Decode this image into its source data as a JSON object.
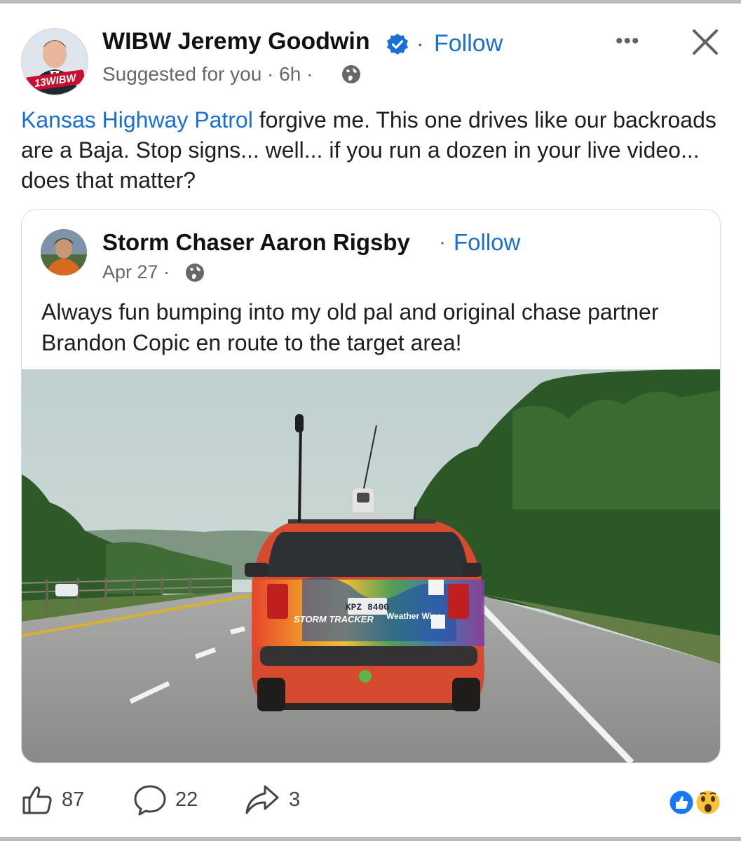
{
  "post": {
    "author": "WIBW Jeremy Goodwin",
    "separator": "·",
    "follow": "Follow",
    "meta": "Suggested for you · 6h ·",
    "more": "•••",
    "mention": "Kansas Highway Patrol",
    "text": " forgive me.  This one drives like our backroads are a Baja.  Stop signs... well... if you run a dozen in your live video... does that matter?",
    "avatar_badge": "13WIBW"
  },
  "shared": {
    "author": "Storm Chaser Aaron Rigsby",
    "separator": "·",
    "follow": "Follow",
    "meta": "Apr 27 ·",
    "text": "Always fun bumping into my old pal and original chase partner Brandon Copic en route to the target area!",
    "plate": "KPZ 840G",
    "decal_left": "STORM TRACKER",
    "decal_right": "Weather Wise"
  },
  "actions": {
    "likes": "87",
    "comments": "22",
    "shares": "3"
  },
  "colors": {
    "accent": "#1a6ed8",
    "text": "#1c1e21",
    "meta": "#65676b"
  },
  "icons": [
    "verified-badge-icon",
    "globe-icon",
    "more-icon",
    "close-icon",
    "like-icon",
    "comment-icon",
    "share-icon",
    "like-reaction-icon",
    "wow-reaction-icon"
  ]
}
